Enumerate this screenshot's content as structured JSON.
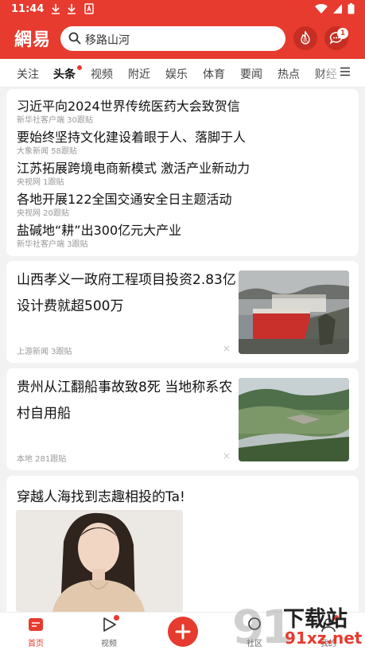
{
  "status_bar": {
    "time": "11:44"
  },
  "header": {
    "logo": "網易",
    "search": {
      "query": "移路山河"
    },
    "hot_badge_label": "热",
    "message_count": "1"
  },
  "tabs": [
    "关注",
    "头条",
    "视频",
    "附近",
    "娱乐",
    "体育",
    "要闻",
    "热点",
    "财经"
  ],
  "headlines": [
    {
      "title": "习近平向2024世界传统医药大会致贺信",
      "meta": "新华社客户端  30跟贴"
    },
    {
      "title": "要始终坚持文化建设着眼于人、落脚于人",
      "meta": "大象新闻  58跟贴"
    },
    {
      "title": "江苏拓展跨境电商新模式 激活产业新动力",
      "meta": "央视网  1跟贴"
    },
    {
      "title": "各地开展122全国交通安全日主题活动",
      "meta": "央视网  20跟贴"
    },
    {
      "title": "盐碱地“耕”出300亿元大产业",
      "meta": "新华社客户端  3跟贴"
    }
  ],
  "news_items": [
    {
      "title": "山西孝义一政府工程项目投资2.83亿 设计费就超500万",
      "meta": "上游新闻  3跟贴",
      "close": "×"
    },
    {
      "title": "贵州从江翻船事故致8死 当地称系农村自用船",
      "meta": "本地  281跟贴",
      "close": "×"
    }
  ],
  "promo": {
    "title": "穿越人海找到志趣相投的Ta!"
  },
  "bottom_nav": {
    "home": "首页",
    "video": "视频",
    "community": "社区",
    "mine": "我的"
  },
  "watermark": {
    "number": "91",
    "text1": "下载站",
    "text2": "91xz.net"
  },
  "colors": {
    "accent": "#e63b2e"
  }
}
